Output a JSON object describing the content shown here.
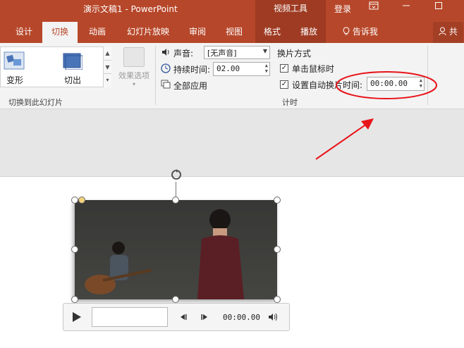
{
  "titlebar": {
    "doc_title": "演示文稿1 - PowerPoint",
    "video_tools": "视频工具",
    "login": "登录",
    "ribbon_display_icon": "ribbon-display-icon",
    "minimize_icon": "minimize-icon",
    "maximize_icon": "maximize-icon"
  },
  "tabs": [
    {
      "label": "设计"
    },
    {
      "label": "切换"
    },
    {
      "label": "动画"
    },
    {
      "label": "幻灯片放映"
    },
    {
      "label": "审阅"
    },
    {
      "label": "视图"
    },
    {
      "label": "格式"
    },
    {
      "label": "播放"
    },
    {
      "label": "告诉我"
    },
    {
      "label": "共"
    }
  ],
  "ribbon": {
    "transitions": {
      "item1": "变形",
      "item2": "切出",
      "effect_options": "效果选项",
      "group_label": "切换到此幻灯片"
    },
    "timing": {
      "sound_label": "声音:",
      "sound_value": "[无声音]",
      "duration_label": "持续时间:",
      "duration_value": "02.00",
      "apply_all": "全部应用",
      "advance_label": "换片方式",
      "on_click": "单击鼠标时",
      "after_label": "设置自动换片时间:",
      "after_value": "00:00.00",
      "group_label": "计时"
    }
  },
  "player": {
    "time": "00:00.00"
  },
  "colors": {
    "accent": "#b7472a",
    "annotation": "#e8141a"
  }
}
